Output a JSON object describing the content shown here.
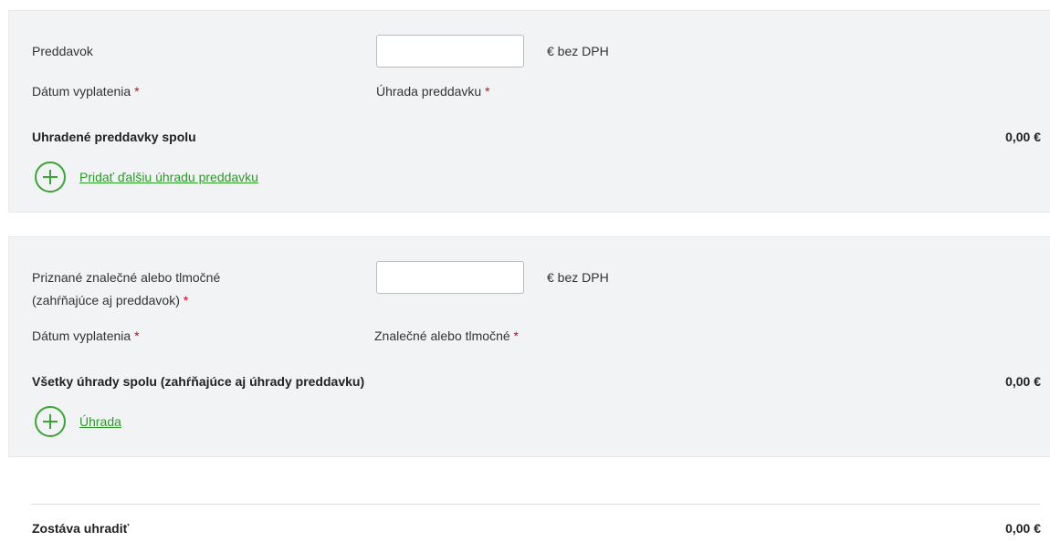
{
  "advance_section": {
    "advance_label": "Preddavok",
    "advance_input_value": "",
    "unit_label": "€ bez DPH",
    "payment_date_label": "Dátum vyplatenia",
    "advance_payment_label": "Úhrada preddavku",
    "required_mark": "*",
    "total_label": "Uhradené preddavky spolu",
    "total_value": "0,00 €",
    "add_link_label": "Pridať ďalšiu úhradu preddavku"
  },
  "fees_section": {
    "granted_label_line1": "Priznané znalečné alebo tlmočné",
    "granted_label_line2": "(zahŕňajúce aj preddavok)",
    "granted_input_value": "",
    "unit_label": "€ bez DPH",
    "payment_date_label": "Dátum vyplatenia",
    "fee_label": "Znalečné alebo tlmočné",
    "required_mark": "*",
    "total_label": "Všetky úhrady spolu (zahŕňajúce aj úhrady preddavku)",
    "total_value": "0,00 €",
    "add_link_label": "Úhrada"
  },
  "summary": {
    "remaining_label": "Zostáva uhradiť",
    "remaining_value": "0,00 €"
  },
  "colors": {
    "accent_green": "#3aa535",
    "required_red": "#e0001b",
    "panel_background": "#f2f3f4"
  }
}
